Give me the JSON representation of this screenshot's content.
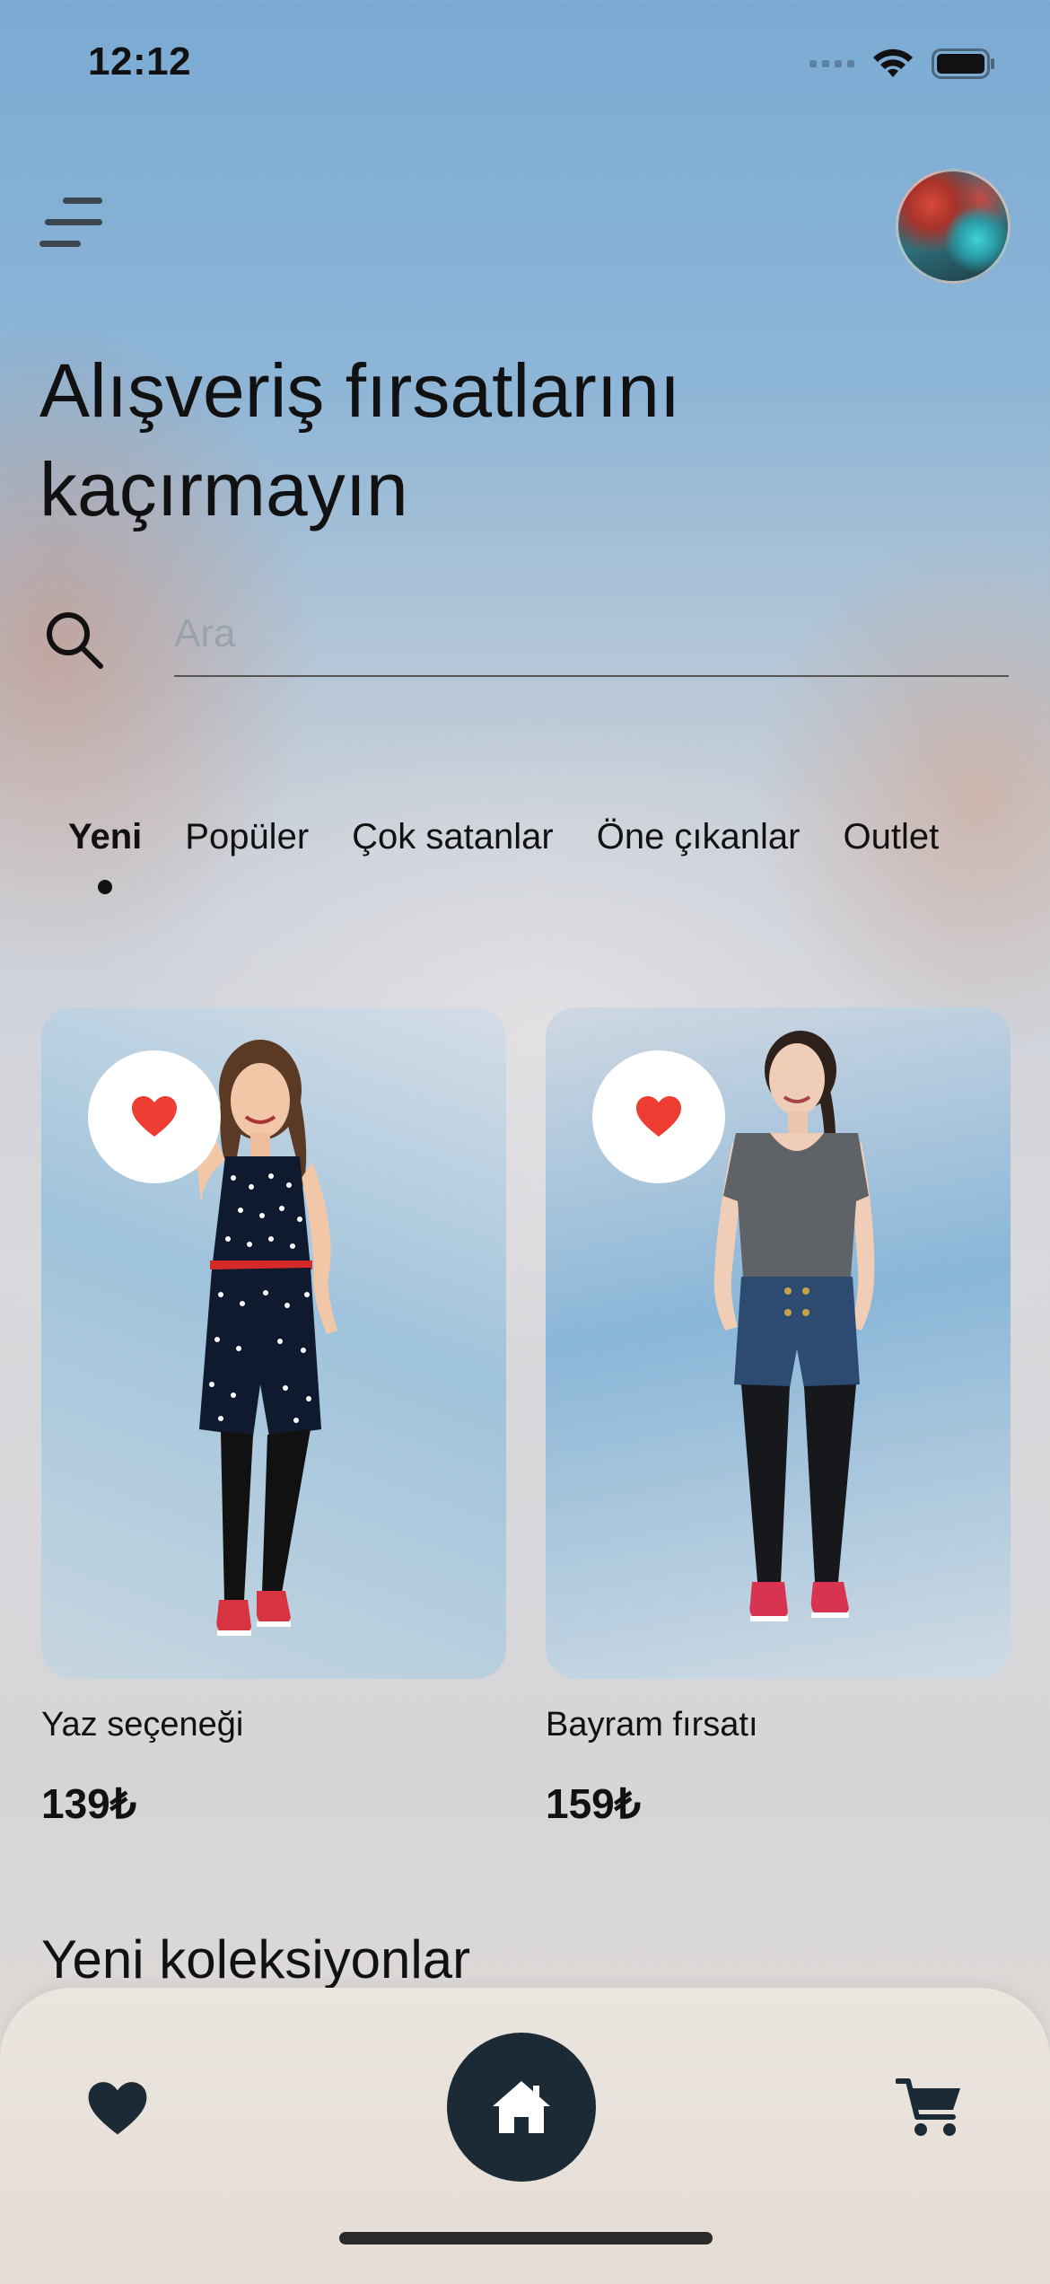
{
  "status_bar": {
    "time": "12:12"
  },
  "header": {
    "title_line1": "Alışveriş fırsatlarını",
    "title_line2": "kaçırmayın"
  },
  "search": {
    "placeholder": "Ara",
    "value": ""
  },
  "tabs": [
    {
      "label": "Yeni",
      "active": true
    },
    {
      "label": "Popüler",
      "active": false
    },
    {
      "label": "Çok satanlar",
      "active": false
    },
    {
      "label": "Öne çıkanlar",
      "active": false
    },
    {
      "label": "Outlet",
      "active": false
    }
  ],
  "products": [
    {
      "name": "Yaz seçeneği",
      "price": "139₺",
      "favorite": true
    },
    {
      "name": "Bayram fırsatı",
      "price": "159₺",
      "favorite": true
    }
  ],
  "section": {
    "title": "Yeni koleksiyonlar"
  },
  "bottom_nav": {
    "items": [
      {
        "icon": "heart-icon"
      },
      {
        "icon": "home-icon",
        "active": true
      },
      {
        "icon": "cart-icon"
      }
    ]
  },
  "colors": {
    "accent_dark": "#1c2a35",
    "favorite_red": "#ee3d33"
  }
}
